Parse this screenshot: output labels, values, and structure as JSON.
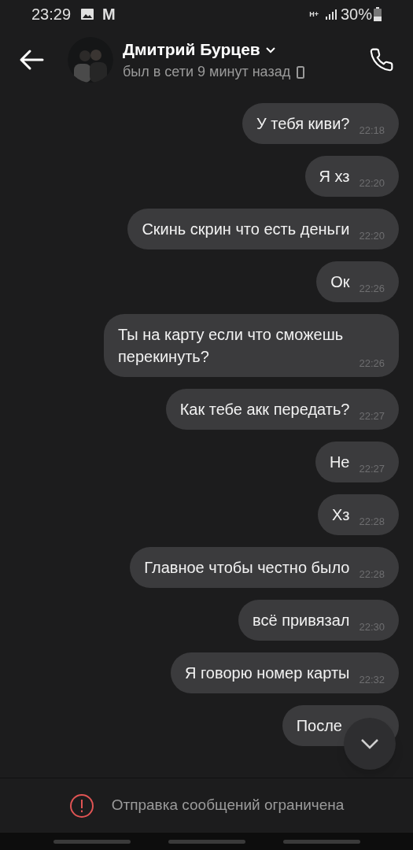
{
  "status_bar": {
    "time": "23:29",
    "notification": "M",
    "network": "H+",
    "battery": "30%"
  },
  "header": {
    "name": "Дмитрий Бурцев",
    "status": "был в сети 9 минут назад"
  },
  "messages": [
    {
      "text": "У тебя киви?",
      "time": "22:18"
    },
    {
      "text": "Я хз",
      "time": "22:20"
    },
    {
      "text": "Скинь скрин что есть деньги",
      "time": "22:20"
    },
    {
      "text": "Ок",
      "time": "22:26"
    },
    {
      "text": "Ты на карту если что сможешь перекинуть?",
      "time": "22:26"
    },
    {
      "text": "Как тебе акк передать?",
      "time": "22:27"
    },
    {
      "text": "Не",
      "time": "22:27"
    },
    {
      "text": "Хз",
      "time": "22:28"
    },
    {
      "text": "Главное чтобы честно было",
      "time": "22:28"
    },
    {
      "text": "всё привязал",
      "time": "22:30"
    },
    {
      "text": "Я говорю номер карты",
      "time": "22:32"
    },
    {
      "text": "После"
    }
  ],
  "notice": "Отправка сообщений ограничена"
}
